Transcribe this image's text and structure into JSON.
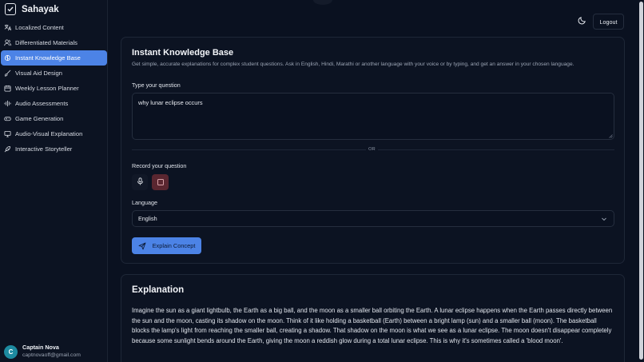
{
  "brand": {
    "name": "Sahayak",
    "icon": "notebook-check-icon"
  },
  "sidebar": {
    "items": [
      {
        "label": "Localized Content",
        "icon": "translate-icon",
        "active": false
      },
      {
        "label": "Differentiated Materials",
        "icon": "users-icon",
        "active": false
      },
      {
        "label": "Instant Knowledge Base",
        "icon": "brain-icon",
        "active": true
      },
      {
        "label": "Visual Aid Design",
        "icon": "brush-icon",
        "active": false
      },
      {
        "label": "Weekly Lesson Planner",
        "icon": "calendar-icon",
        "active": false
      },
      {
        "label": "Audio Assessments",
        "icon": "audio-wave-icon",
        "active": false
      },
      {
        "label": "Game Generation",
        "icon": "gamepad-icon",
        "active": false
      },
      {
        "label": "Audio-Visual Explanation",
        "icon": "monitor-icon",
        "active": false
      },
      {
        "label": "Interactive Storyteller",
        "icon": "feather-icon",
        "active": false
      }
    ]
  },
  "user": {
    "initial": "C",
    "name": "Captain Nova",
    "email": "captnovaoff@gmail.com"
  },
  "header": {
    "logout_label": "Logout",
    "theme_icon": "moon-icon"
  },
  "form": {
    "title": "Instant Knowledge Base",
    "subtitle": "Get simple, accurate explanations for complex student questions. Ask in English, Hindi, Marathi or another language with your voice or by typing, and get an answer in your chosen language.",
    "question_label": "Type your question",
    "question_value": "why lunar eclipse occurs",
    "or_label": "OR",
    "record_label": "Record your question",
    "language_label": "Language",
    "language_value": "English",
    "submit_label": "Explain Concept"
  },
  "result": {
    "title": "Explanation",
    "text": "Imagine the sun as a giant lightbulb, the Earth as a big ball, and the moon as a smaller ball orbiting the Earth.  A lunar eclipse happens when the Earth passes directly between the sun and the moon, casting its shadow on the moon.  Think of it like holding a basketball (Earth) between a bright lamp (sun) and a smaller ball (moon). The basketball blocks the lamp's light from reaching the smaller ball, creating a shadow. That shadow on the moon is what we see as a lunar eclipse.  The moon doesn't disappear completely because some sunlight bends around the Earth, giving the moon a reddish glow during a total lunar eclipse. This is why it's sometimes called a 'blood moon'."
  },
  "colors": {
    "accent": "#4c83e6",
    "background": "#0a1120",
    "stop_button": "#5a2630"
  }
}
